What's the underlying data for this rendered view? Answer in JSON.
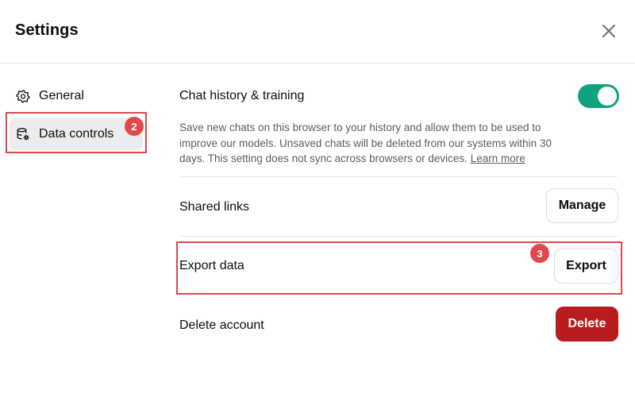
{
  "header": {
    "title": "Settings"
  },
  "sidebar": {
    "items": [
      {
        "label": "General",
        "icon": "gear-icon"
      },
      {
        "label": "Data controls",
        "icon": "database-settings-icon"
      }
    ]
  },
  "annotations": {
    "badge_2": "2",
    "badge_3": "3",
    "color": "#e0484a"
  },
  "main": {
    "chat_history": {
      "label": "Chat history & training",
      "description": "Save new chats on this browser to your history and allow them to be used to improve our models. Unsaved chats will be deleted from our systems within 30 days. This setting does not sync across browsers or devices.",
      "learn_more": "Learn more",
      "toggle_on": true,
      "toggle_color": "#10a37f"
    },
    "shared_links": {
      "label": "Shared links",
      "button": "Manage"
    },
    "export_data": {
      "label": "Export data",
      "button": "Export"
    },
    "delete_account": {
      "label": "Delete account",
      "button": "Delete",
      "button_color": "#b91c1c"
    }
  }
}
